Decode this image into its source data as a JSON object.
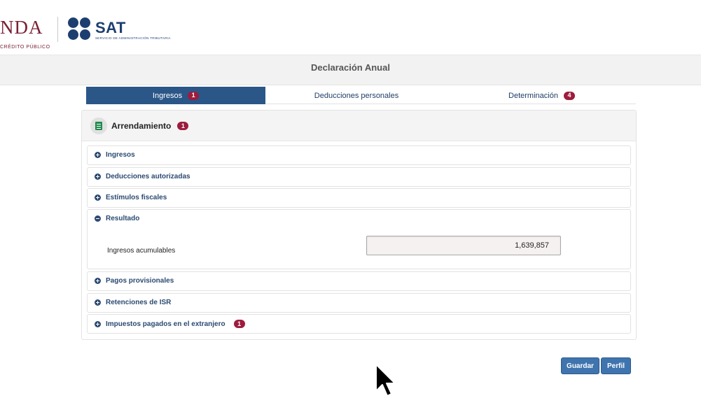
{
  "header": {
    "hacienda_big": "NDA",
    "hacienda_small": "CRÉDITO PÚBLICO",
    "sat_text": "SAT",
    "sat_sub": "SERVICIO DE ADMINISTRACIÓN TRIBUTARIA",
    "brand_colors": {
      "hacienda": "#7b2134",
      "sat": "#1d3f70"
    }
  },
  "page_title": "Declaración Anual",
  "tabs": [
    {
      "label": "Ingresos",
      "badge": "1",
      "active": true
    },
    {
      "label": "Deducciones personales",
      "badge": "",
      "active": false
    },
    {
      "label": "Determinación",
      "badge": "4",
      "active": false
    }
  ],
  "panel": {
    "icon": "document-icon",
    "title": "Arrendamiento",
    "badge": "1",
    "sections": [
      {
        "label": "Ingresos",
        "state": "collapsed"
      },
      {
        "label": "Deducciones autorizadas",
        "state": "collapsed"
      },
      {
        "label": "Estímulos fiscales",
        "state": "collapsed"
      },
      {
        "label": "Resultado",
        "state": "expanded",
        "field_label": "Ingresos acumulables",
        "field_value": "1,639,857"
      },
      {
        "label": "Pagos provisionales",
        "state": "collapsed"
      },
      {
        "label": "Retenciones de ISR",
        "state": "collapsed"
      },
      {
        "label": "Impuestos pagados en el extranjero",
        "state": "collapsed",
        "badge": "1"
      }
    ]
  },
  "buttons": {
    "save": "Guardar",
    "profile": "Perfil"
  },
  "colors": {
    "accent": "#2b5688",
    "badge": "#9d1c3d",
    "button": "#3f74ae"
  }
}
